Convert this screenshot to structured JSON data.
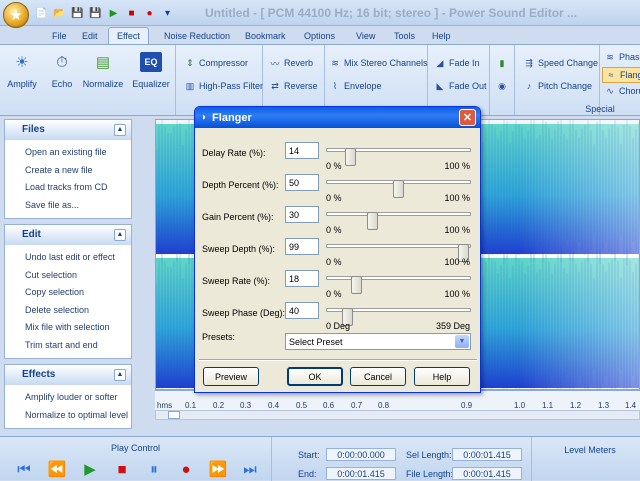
{
  "app": {
    "title": "Untitled - [ PCM 44100 Hz; 16 bit; stereo ] - Power Sound Editor ...",
    "app_icon": "star-icon"
  },
  "tabs": [
    {
      "label": "File"
    },
    {
      "label": "Edit"
    },
    {
      "label": "Effect"
    },
    {
      "label": "Noise Reduction"
    },
    {
      "label": "Bookmark"
    },
    {
      "label": "Options"
    },
    {
      "label": "View"
    },
    {
      "label": "Tools"
    },
    {
      "label": "Help"
    }
  ],
  "ribbon": {
    "big_buttons": [
      {
        "label": "Amplify"
      },
      {
        "label": "Echo"
      },
      {
        "label": "Normalize"
      },
      {
        "label": "Equalizer",
        "icon_text": "EQ"
      }
    ],
    "group2": [
      {
        "label": "Compressor"
      },
      {
        "label": "High-Pass Filter"
      }
    ],
    "group3": [
      {
        "label": "Reverb"
      },
      {
        "label": "Reverse"
      }
    ],
    "group4": [
      {
        "label": "Mix Stereo Channels"
      },
      {
        "label": "Envelope"
      }
    ],
    "group5": [
      {
        "label": "Fade In"
      },
      {
        "label": "Fade Out"
      }
    ],
    "group6": [
      {
        "label": "Speed Change"
      },
      {
        "label": "Pitch Change"
      }
    ],
    "special_label": "Special",
    "group7": [
      {
        "label": "Phase"
      },
      {
        "label": "Flange"
      },
      {
        "label": "Chorus"
      }
    ]
  },
  "sidebar": {
    "panels": [
      {
        "title": "Files",
        "items": [
          "Open an existing file",
          "Create a new file",
          "Load tracks from CD",
          "Save file as..."
        ]
      },
      {
        "title": "Edit",
        "items": [
          "Undo last edit or effect",
          "Cut selection",
          "Copy selection",
          "Delete selection",
          "Mix file with selection",
          "Trim start and end"
        ]
      },
      {
        "title": "Effects",
        "items": [
          "Amplify louder or softer",
          "Normalize to optimal level"
        ]
      }
    ]
  },
  "ruler": {
    "unit": "hms",
    "ticks": [
      "0.1",
      "0.2",
      "0.3",
      "0.4",
      "0.5",
      "0.6",
      "0.7",
      "0.8",
      "0.9",
      "1.0",
      "1.1",
      "1.2",
      "1.3",
      "1.4"
    ]
  },
  "play_control": {
    "title": "Play Control",
    "buttons": [
      "skip-start-icon",
      "rewind-icon",
      "play-icon",
      "stop-icon",
      "pause-icon",
      "record-icon",
      "fast-forward-icon",
      "skip-end-icon"
    ]
  },
  "time_info": {
    "start_label": "Start:",
    "start": "0:00:00.000",
    "end_label": "End:",
    "end": "0:00:01.415",
    "sel_length_label": "Sel Length:",
    "sel_length": "0:00:01.415",
    "file_length_label": "File Length:",
    "file_length": "0:00:01.415"
  },
  "level_meters": {
    "title": "Level Meters"
  },
  "dialog": {
    "title": "Flanger",
    "params": [
      {
        "label": "Delay Rate (%):",
        "value": "14",
        "level": 0.14,
        "min": "0 %",
        "max": "100 %"
      },
      {
        "label": "Depth Percent (%):",
        "value": "50",
        "level": 0.5,
        "min": "0 %",
        "max": "100 %"
      },
      {
        "label": "Gain Percent (%):",
        "value": "30",
        "level": 0.3,
        "min": "0 %",
        "max": "100 %"
      },
      {
        "label": "Sweep Depth (%):",
        "value": "99",
        "level": 0.99,
        "min": "0 %",
        "max": "100 %"
      },
      {
        "label": "Sweep Rate (%):",
        "value": "18",
        "level": 0.18,
        "min": "0 %",
        "max": "100 %"
      },
      {
        "label": "Sweep Phase (Deg):",
        "value": "40",
        "level": 0.11,
        "min": "0 Deg",
        "max": "359 Deg"
      }
    ],
    "presets_label": "Presets:",
    "preset_value": "Select Preset",
    "buttons": {
      "preview": "Preview",
      "ok": "OK",
      "cancel": "Cancel",
      "help": "Help"
    }
  }
}
